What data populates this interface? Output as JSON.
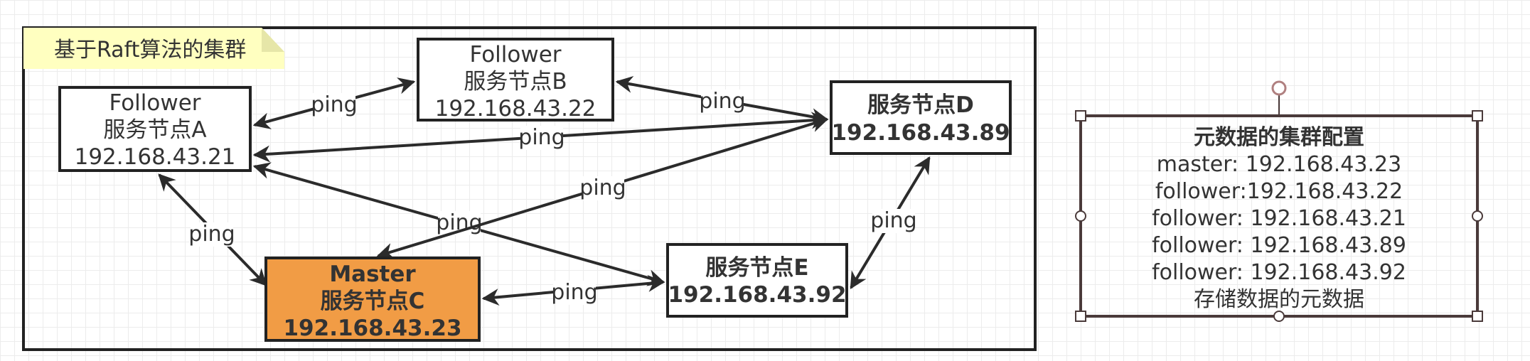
{
  "cluster": {
    "title": "基于Raft算法的集群"
  },
  "nodes": {
    "a": {
      "lines": [
        "Follower",
        "服务节点A",
        "192.168.43.21"
      ]
    },
    "b": {
      "lines": [
        "Follower",
        "服务节点B",
        "192.168.43.22"
      ]
    },
    "c": {
      "lines": [
        "Master",
        "服务节点C",
        "192.168.43.23"
      ]
    },
    "d": {
      "lines": [
        "服务节点D",
        "192.168.43.89"
      ]
    },
    "e": {
      "lines": [
        "服务节点E",
        "192.168.43.92"
      ]
    }
  },
  "edges": [
    {
      "from": "a",
      "to": "b",
      "label": "ping"
    },
    {
      "from": "a",
      "to": "d",
      "label": "ping"
    },
    {
      "from": "a",
      "to": "c",
      "label": "ping"
    },
    {
      "from": "a",
      "to": "e",
      "label": "ping"
    },
    {
      "from": "b",
      "to": "d",
      "label": "ping"
    },
    {
      "from": "c",
      "to": "d",
      "label": "ping"
    },
    {
      "from": "c",
      "to": "e",
      "label": "ping"
    },
    {
      "from": "d",
      "to": "e",
      "label": "ping"
    }
  ],
  "metadata": {
    "title": "元数据的集群配置",
    "lines": [
      "master: 192.168.43.23",
      "follower:192.168.43.22",
      "follower: 192.168.43.21",
      "follower: 192.168.43.89",
      "follower: 192.168.43.92",
      "存储数据的元数据"
    ]
  },
  "colors": {
    "master_fill": "#F19C45",
    "node_fill": "#ffffff",
    "stroke": "#222222",
    "note_fill": "#FFFFC0",
    "note_fold": "#E6E6A8",
    "selection": "#4A3A3A",
    "arrow": "#2b2b2b"
  }
}
